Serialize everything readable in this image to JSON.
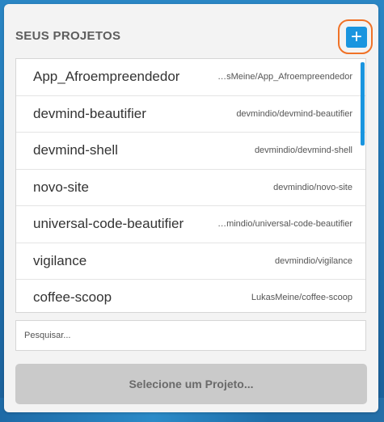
{
  "header": {
    "title": "SEUS PROJETOS",
    "add_icon": "plus-icon",
    "add_symbol": "+"
  },
  "projects": [
    {
      "name": "App_Afroempreendedor",
      "path": "LukasMeine/App_Afroempreendedor"
    },
    {
      "name": "devmind-beautifier",
      "path": "devmindio/devmind-beautifier"
    },
    {
      "name": "devmind-shell",
      "path": "devmindio/devmind-shell"
    },
    {
      "name": "novo-site",
      "path": "devmindio/novo-site"
    },
    {
      "name": "universal-code-beautifier",
      "path": "devmindio/universal-code-beautifier"
    },
    {
      "name": "vigilance",
      "path": "devmindio/vigilance"
    },
    {
      "name": "coffee-scoop",
      "path": "LukasMeine/coffee-scoop"
    }
  ],
  "search": {
    "placeholder": "Pesquisar...",
    "value": ""
  },
  "select_button": {
    "label": "Selecione um Projeto..."
  },
  "colors": {
    "accent": "#1a95df",
    "highlight": "#f07227",
    "button_disabled": "#cacaca"
  }
}
